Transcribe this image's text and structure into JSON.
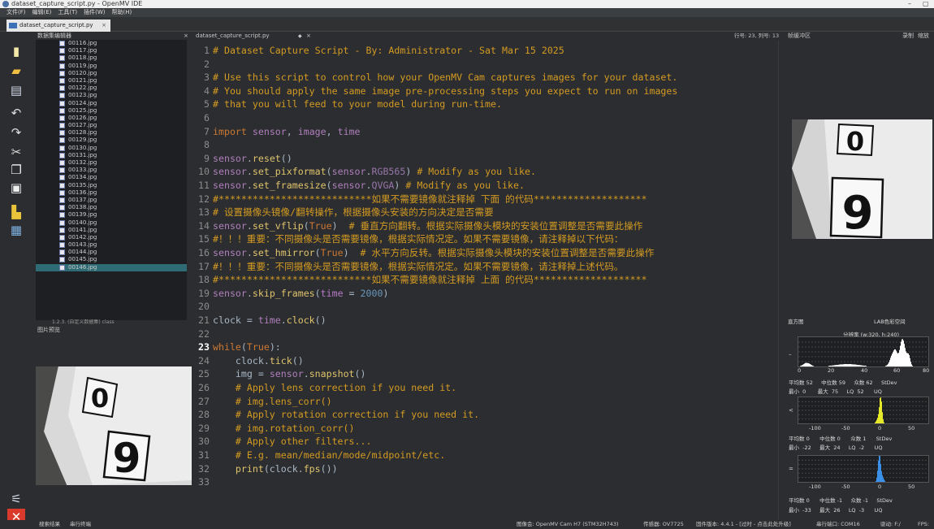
{
  "window": {
    "title": "dataset_capture_script.py - OpenMV IDE",
    "min": "–",
    "max": "▢"
  },
  "menu": [
    "文件(F)",
    "编辑(E)",
    "工具(T)",
    "插件(W)",
    "帮助(H)"
  ],
  "file_tab": {
    "label": "dataset_capture_script.py",
    "close": "×"
  },
  "dataset_editor": {
    "title": "数据集编辑器",
    "close": "×",
    "files": [
      "00116.jpg",
      "00117.jpg",
      "00118.jpg",
      "00119.jpg",
      "00120.jpg",
      "00121.jpg",
      "00122.jpg",
      "00123.jpg",
      "00124.jpg",
      "00125.jpg",
      "00126.jpg",
      "00127.jpg",
      "00128.jpg",
      "00129.jpg",
      "00130.jpg",
      "00131.jpg",
      "00132.jpg",
      "00133.jpg",
      "00134.jpg",
      "00135.jpg",
      "00136.jpg",
      "00137.jpg",
      "00138.jpg",
      "00139.jpg",
      "00140.jpg",
      "00141.jpg",
      "00142.jpg",
      "00143.jpg",
      "00144.jpg",
      "00145.jpg",
      "00146.jpg"
    ],
    "folder": "1.2.3. (自定义数据集) class"
  },
  "image_preview": {
    "title": "图片预览"
  },
  "editor": {
    "filename": "dataset_capture_script.py",
    "dropdown": "◆",
    "close": "×",
    "position": "行号: 23, 列号: 13"
  },
  "frame_buffer": {
    "title": "帧缓冲区",
    "record": "录制",
    "zoom": "缩放"
  },
  "histogram": {
    "title": "直方图",
    "colorspace": "LAB色彩空间",
    "resolution": "分辨率 (w:320, h:240)",
    "channels": [
      {
        "axis": [
          "0",
          "20",
          "40",
          "60",
          "80"
        ],
        "row1": "平均数 52     中位数 59     众数 62     StDev",
        "row2": "最小  0       最大  75     LQ  52      UQ",
        "color": "#ffffff"
      },
      {
        "axis": [
          "-100",
          "-50",
          "0",
          "50"
        ],
        "row1": "平均数 0      中位数 0      众数 1      StDev",
        "row2": "最小  -22     最大  24     LQ  -2      UQ",
        "color": "#e6e82a"
      },
      {
        "axis": [
          "-100",
          "-50",
          "0",
          "50"
        ],
        "row1": "平均数 0      中位数 -1     众数 -1     StDev",
        "row2": "最小  -33     最大  26     LQ  -3      UQ",
        "color": "#3a8fe8"
      }
    ]
  },
  "status": {
    "search": "搜索结果",
    "serial": "串行终端",
    "board": "图像会: OpenMV Cam H7 (STM32H743)",
    "sensor": "传感器: OV7725",
    "firmware": "固件版本: 4.4.1 - [过时 - 点击此处升级]",
    "port": "串行端口: COM16",
    "drive": "驱动: F:/",
    "fps": "FPS:"
  },
  "photo_digits": {
    "top": "0",
    "bottom": "9"
  },
  "code": [
    {
      "n": "1",
      "p": [
        [
          "c-cm",
          "# Dataset Capture Script - By: Administrator - Sat Mar 15 2025"
        ]
      ]
    },
    {
      "n": "2",
      "p": []
    },
    {
      "n": "3",
      "p": [
        [
          "c-cm",
          "# Use this script to control how your OpenMV Cam captures images for your dataset."
        ]
      ]
    },
    {
      "n": "4",
      "p": [
        [
          "c-cm",
          "# You should apply the same image pre-processing steps you expect to run on images"
        ]
      ]
    },
    {
      "n": "5",
      "p": [
        [
          "c-cm",
          "# that you will feed to your model during run-time."
        ]
      ]
    },
    {
      "n": "6",
      "p": []
    },
    {
      "n": "7",
      "p": [
        [
          "c-kw",
          "import "
        ],
        [
          "c-mod",
          "sensor"
        ],
        [
          "c-id",
          ", "
        ],
        [
          "c-mod",
          "image"
        ],
        [
          "c-id",
          ", "
        ],
        [
          "c-mod",
          "time"
        ]
      ]
    },
    {
      "n": "8",
      "p": []
    },
    {
      "n": "9",
      "p": [
        [
          "c-mod",
          "sensor"
        ],
        [
          "c-id",
          "."
        ],
        [
          "c-fn",
          "reset"
        ],
        [
          "c-id",
          "()"
        ]
      ]
    },
    {
      "n": "10",
      "p": [
        [
          "c-mod",
          "sensor"
        ],
        [
          "c-id",
          "."
        ],
        [
          "c-fn",
          "set_pixformat"
        ],
        [
          "c-id",
          "("
        ],
        [
          "c-mod",
          "sensor"
        ],
        [
          "c-id",
          "."
        ],
        [
          "c-cn",
          "RGB565"
        ],
        [
          "c-id",
          ") "
        ],
        [
          "c-cm",
          "# Modify as you like."
        ]
      ]
    },
    {
      "n": "11",
      "p": [
        [
          "c-mod",
          "sensor"
        ],
        [
          "c-id",
          "."
        ],
        [
          "c-fn",
          "set_framesize"
        ],
        [
          "c-id",
          "("
        ],
        [
          "c-mod",
          "sensor"
        ],
        [
          "c-id",
          "."
        ],
        [
          "c-cn",
          "QVGA"
        ],
        [
          "c-id",
          ") "
        ],
        [
          "c-cm",
          "# Modify as you like."
        ]
      ]
    },
    {
      "n": "12",
      "p": [
        [
          "c-cm",
          "#***************************如果不需要镜像就注释掉 下面 的代码********************"
        ]
      ]
    },
    {
      "n": "13",
      "p": [
        [
          "c-cm",
          "# 设置摄像头镜像/翻转操作，根据摄像头安装的方向决定是否需要"
        ]
      ]
    },
    {
      "n": "14",
      "p": [
        [
          "c-mod",
          "sensor"
        ],
        [
          "c-id",
          "."
        ],
        [
          "c-fn",
          "set_vflip"
        ],
        [
          "c-id",
          "("
        ],
        [
          "c-kw",
          "True"
        ],
        [
          "c-id",
          ")  "
        ],
        [
          "c-cm",
          "# 垂直方向翻转。根据实际摄像头模块的安装位置调整是否需要此操作"
        ]
      ]
    },
    {
      "n": "15",
      "p": [
        [
          "c-cm",
          "#！！！重要：不同摄像头是否需要镜像，根据实际情况定。如果不需要镜像，请注释掉以下代码："
        ]
      ]
    },
    {
      "n": "16",
      "p": [
        [
          "c-mod",
          "sensor"
        ],
        [
          "c-id",
          "."
        ],
        [
          "c-fn",
          "set_hmirror"
        ],
        [
          "c-id",
          "("
        ],
        [
          "c-kw",
          "True"
        ],
        [
          "c-id",
          ")  "
        ],
        [
          "c-cm",
          "# 水平方向反转。根据实际摄像头模块的安装位置调整是否需要此操作"
        ]
      ]
    },
    {
      "n": "17",
      "p": [
        [
          "c-cm",
          "#！！！重要：不同摄像头是否需要镜像，根据实际情况定。如果不需要镜像，请注释掉上述代码。"
        ]
      ]
    },
    {
      "n": "18",
      "p": [
        [
          "c-cm",
          "#***************************如果不需要镜像就注释掉 上面 的代码********************"
        ]
      ]
    },
    {
      "n": "19",
      "p": [
        [
          "c-mod",
          "sensor"
        ],
        [
          "c-id",
          "."
        ],
        [
          "c-fn",
          "skip_frames"
        ],
        [
          "c-id",
          "("
        ],
        [
          "c-mg",
          "time"
        ],
        [
          "c-id",
          " = "
        ],
        [
          "c-num",
          "2000"
        ],
        [
          "c-id",
          ")"
        ]
      ]
    },
    {
      "n": "20",
      "p": []
    },
    {
      "n": "21",
      "p": [
        [
          "c-id",
          "clock = "
        ],
        [
          "c-mod",
          "time"
        ],
        [
          "c-id",
          "."
        ],
        [
          "c-fn",
          "clock"
        ],
        [
          "c-id",
          "()"
        ]
      ]
    },
    {
      "n": "22",
      "p": []
    },
    {
      "n": "23",
      "b": true,
      "p": [
        [
          "c-kw",
          "while"
        ],
        [
          "c-id",
          "("
        ],
        [
          "c-kw",
          "True"
        ],
        [
          "c-id",
          "):"
        ]
      ]
    },
    {
      "n": "24",
      "p": [
        [
          "c-id",
          "    clock."
        ],
        [
          "c-fn",
          "tick"
        ],
        [
          "c-id",
          "()"
        ]
      ]
    },
    {
      "n": "25",
      "p": [
        [
          "c-id",
          "    img = "
        ],
        [
          "c-mod",
          "sensor"
        ],
        [
          "c-id",
          "."
        ],
        [
          "c-fn",
          "snapshot"
        ],
        [
          "c-id",
          "()"
        ]
      ]
    },
    {
      "n": "26",
      "p": [
        [
          "c-cm",
          "    # Apply lens correction if you need it."
        ]
      ]
    },
    {
      "n": "27",
      "p": [
        [
          "c-cm",
          "    # img.lens_corr()"
        ]
      ]
    },
    {
      "n": "28",
      "p": [
        [
          "c-cm",
          "    # Apply rotation correction if you need it."
        ]
      ]
    },
    {
      "n": "29",
      "p": [
        [
          "c-cm",
          "    # img.rotation_corr()"
        ]
      ]
    },
    {
      "n": "30",
      "p": [
        [
          "c-cm",
          "    # Apply other filters..."
        ]
      ]
    },
    {
      "n": "31",
      "p": [
        [
          "c-cm",
          "    # E.g. mean/median/mode/midpoint/etc."
        ]
      ]
    },
    {
      "n": "32",
      "p": [
        [
          "c-id",
          "    "
        ],
        [
          "c-fn",
          "print"
        ],
        [
          "c-id",
          "(clock."
        ],
        [
          "c-fn",
          "fps"
        ],
        [
          "c-id",
          "())"
        ]
      ]
    },
    {
      "n": "33",
      "p": []
    }
  ]
}
